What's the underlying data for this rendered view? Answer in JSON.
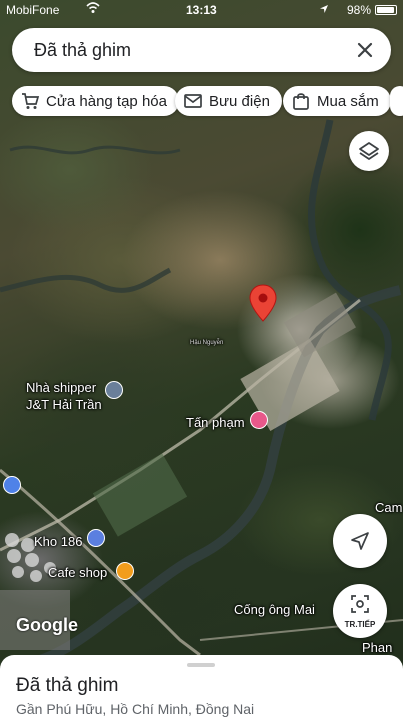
{
  "status_bar": {
    "carrier": "MobiFone",
    "time": "13:13",
    "battery": "98%"
  },
  "search": {
    "text": "Đã thả ghim"
  },
  "chips": [
    {
      "label": "Cửa hàng tạp hóa",
      "icon": "cart-icon"
    },
    {
      "label": "Bưu điện",
      "icon": "mail-icon"
    },
    {
      "label": "Mua sắm",
      "icon": "shopping-bag-icon"
    }
  ],
  "map": {
    "labels": {
      "shipper_line1": "Nhà shipper",
      "shipper_line2": "J&T Hải Trần",
      "tan_pham": "Tấn phạm",
      "kho": "Kho 186",
      "cafe": "Cafe shop",
      "cong_ong": "Cống ông Mai",
      "cam": "Cam",
      "phan": "Phan",
      "tiny": "Hậu Nguyễn"
    },
    "pin_color": "#ea4335",
    "poi_colors": {
      "shipper": "#6a7f9a",
      "tan_pham": "#e8588a",
      "kho": "#5b7fe0",
      "cafe": "#f29d1c",
      "left_edge": "#4f82e8"
    },
    "logo": "Google"
  },
  "controls": {
    "next_label": "TR.TIẾP"
  },
  "sheet": {
    "title": "Đã thả ghim",
    "subtitle": "Gần Phú Hữu, Hồ Chí Minh, Đồng Nai"
  }
}
